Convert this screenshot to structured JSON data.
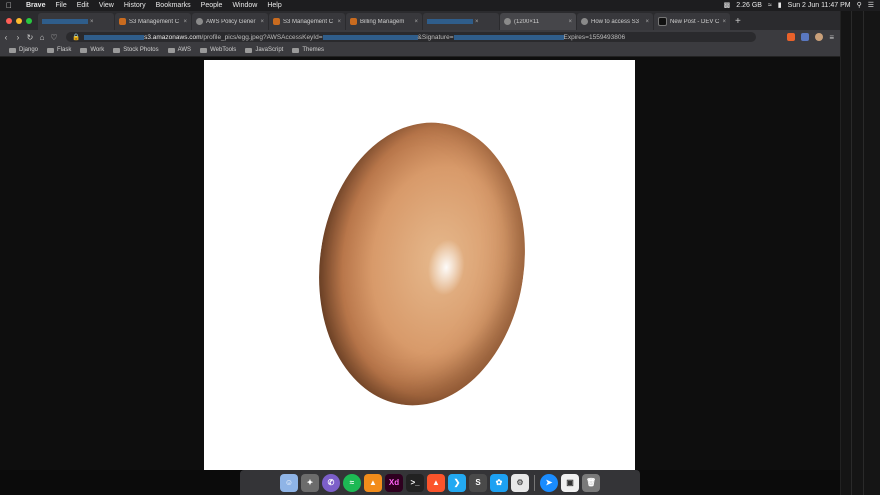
{
  "menubar": {
    "app_name": "Brave",
    "menus": [
      "File",
      "Edit",
      "View",
      "History",
      "Bookmarks",
      "People",
      "Window",
      "Help"
    ],
    "memory": "2.26 GB",
    "clock": "Sun 2 Jun  11:47 PM"
  },
  "tabs": [
    {
      "label": "",
      "icon": "redacted"
    },
    {
      "label": "S3 Management C",
      "icon": "aws-icon"
    },
    {
      "label": "AWS Policy Gener",
      "icon": "globe-icon"
    },
    {
      "label": "S3 Management C",
      "icon": "aws-icon"
    },
    {
      "label": "Billing Managem",
      "icon": "aws-icon"
    },
    {
      "label": "",
      "icon": "redacted"
    },
    {
      "label": "(1200×11",
      "icon": "globe-icon",
      "active": true
    },
    {
      "label": "How to access S3",
      "icon": "globe-icon"
    },
    {
      "label": "New Post - DEV C",
      "icon": "dev-icon"
    }
  ],
  "address": {
    "host": "s3.amazonaws.com",
    "path": "/profile_pics/egg.jpeg?AWSAccessKeyId=",
    "signature_label": "&Signature=",
    "expires": "Expires=1559493806"
  },
  "bookmarks": [
    "Django",
    "Flask",
    "Work",
    "Stock Photos",
    "AWS",
    "WebTools",
    "JavaScript",
    "Themes"
  ],
  "dock": {
    "apps": [
      "finder-icon",
      "launchpad-icon",
      "viber-icon",
      "spotify-icon",
      "vlc-icon",
      "xd-icon",
      "terminal-icon",
      "brave-icon",
      "vscode-icon",
      "sublime-icon",
      "twitter-icon",
      "settings-icon",
      "safari-icon",
      "preview-icon",
      "trash-icon"
    ],
    "xd_label": "Xd"
  },
  "colors": {
    "menubar": "#1d1d1f",
    "tabstrip": "#2b2b2e",
    "toolbar": "#3b3b3f",
    "image_bg": "#ffffff",
    "egg": "#d89a6a"
  }
}
